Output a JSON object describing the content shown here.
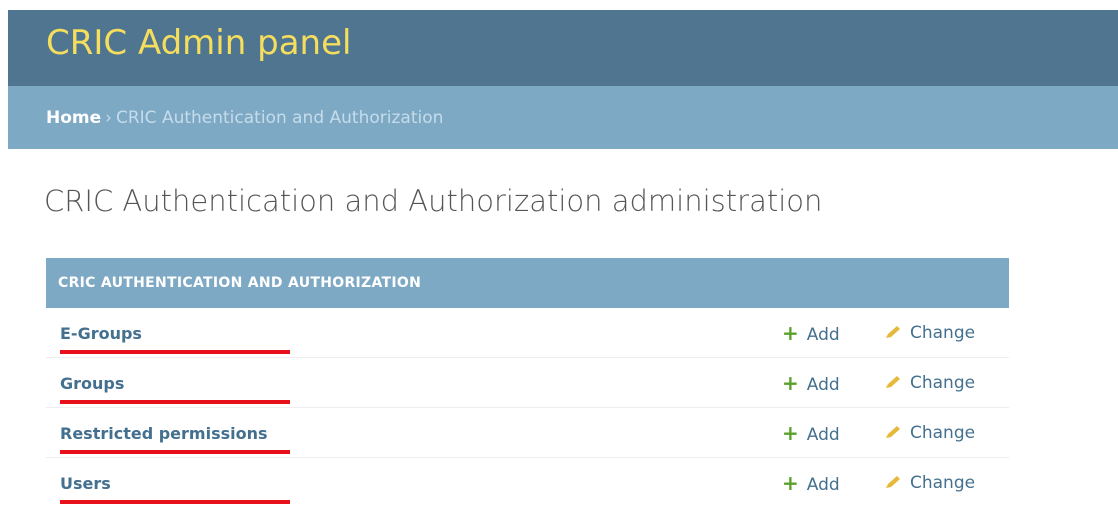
{
  "header": {
    "site_title": "CRIC Admin panel"
  },
  "breadcrumbs": {
    "home": "Home",
    "separator": "›",
    "current": "CRIC Authentication and Authorization"
  },
  "page": {
    "title": "CRIC Authentication and Authorization administration"
  },
  "module": {
    "caption": "CRIC AUTHENTICATION AND AUTHORIZATION",
    "add_label": "Add",
    "change_label": "Change",
    "add_icon": "+",
    "rows": [
      {
        "name": "E-Groups"
      },
      {
        "name": "Groups"
      },
      {
        "name": "Restricted permissions"
      },
      {
        "name": "Users"
      }
    ]
  },
  "colors": {
    "header_bg": "#4f7590",
    "breadcrumb_bg": "#7ea9c5",
    "title_yellow": "#f5dd5d",
    "link_blue": "#44708f",
    "add_green": "#5aa02c",
    "pencil_yellow": "#e6b93a",
    "annotation_red": "#e8101a"
  },
  "icons": {
    "add": "plus-icon",
    "change": "pencil-icon"
  }
}
